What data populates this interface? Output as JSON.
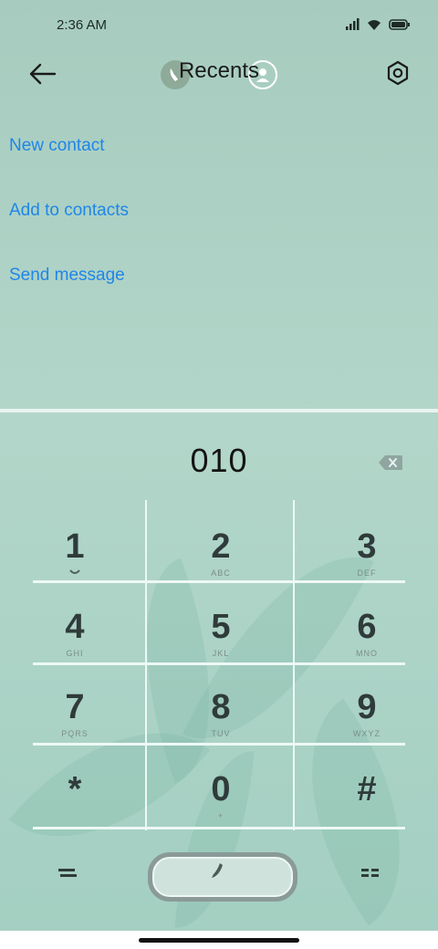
{
  "status_bar": {
    "time": "2:36 AM"
  },
  "header": {
    "title": "Recents"
  },
  "actions": {
    "new_contact": "New contact",
    "add_to_contacts": "Add to contacts",
    "send_message": "Send message"
  },
  "dialer": {
    "number": "010",
    "keys": [
      {
        "digit": "1",
        "letters": ""
      },
      {
        "digit": "2",
        "letters": "ABC"
      },
      {
        "digit": "3",
        "letters": "DEF"
      },
      {
        "digit": "4",
        "letters": "GHI"
      },
      {
        "digit": "5",
        "letters": "JKL"
      },
      {
        "digit": "6",
        "letters": "MNO"
      },
      {
        "digit": "7",
        "letters": "PQRS"
      },
      {
        "digit": "8",
        "letters": "TUV"
      },
      {
        "digit": "9",
        "letters": "WXYZ"
      },
      {
        "digit": "*",
        "letters": ""
      },
      {
        "digit": "0",
        "letters": "+"
      },
      {
        "digit": "#",
        "letters": ""
      }
    ]
  }
}
